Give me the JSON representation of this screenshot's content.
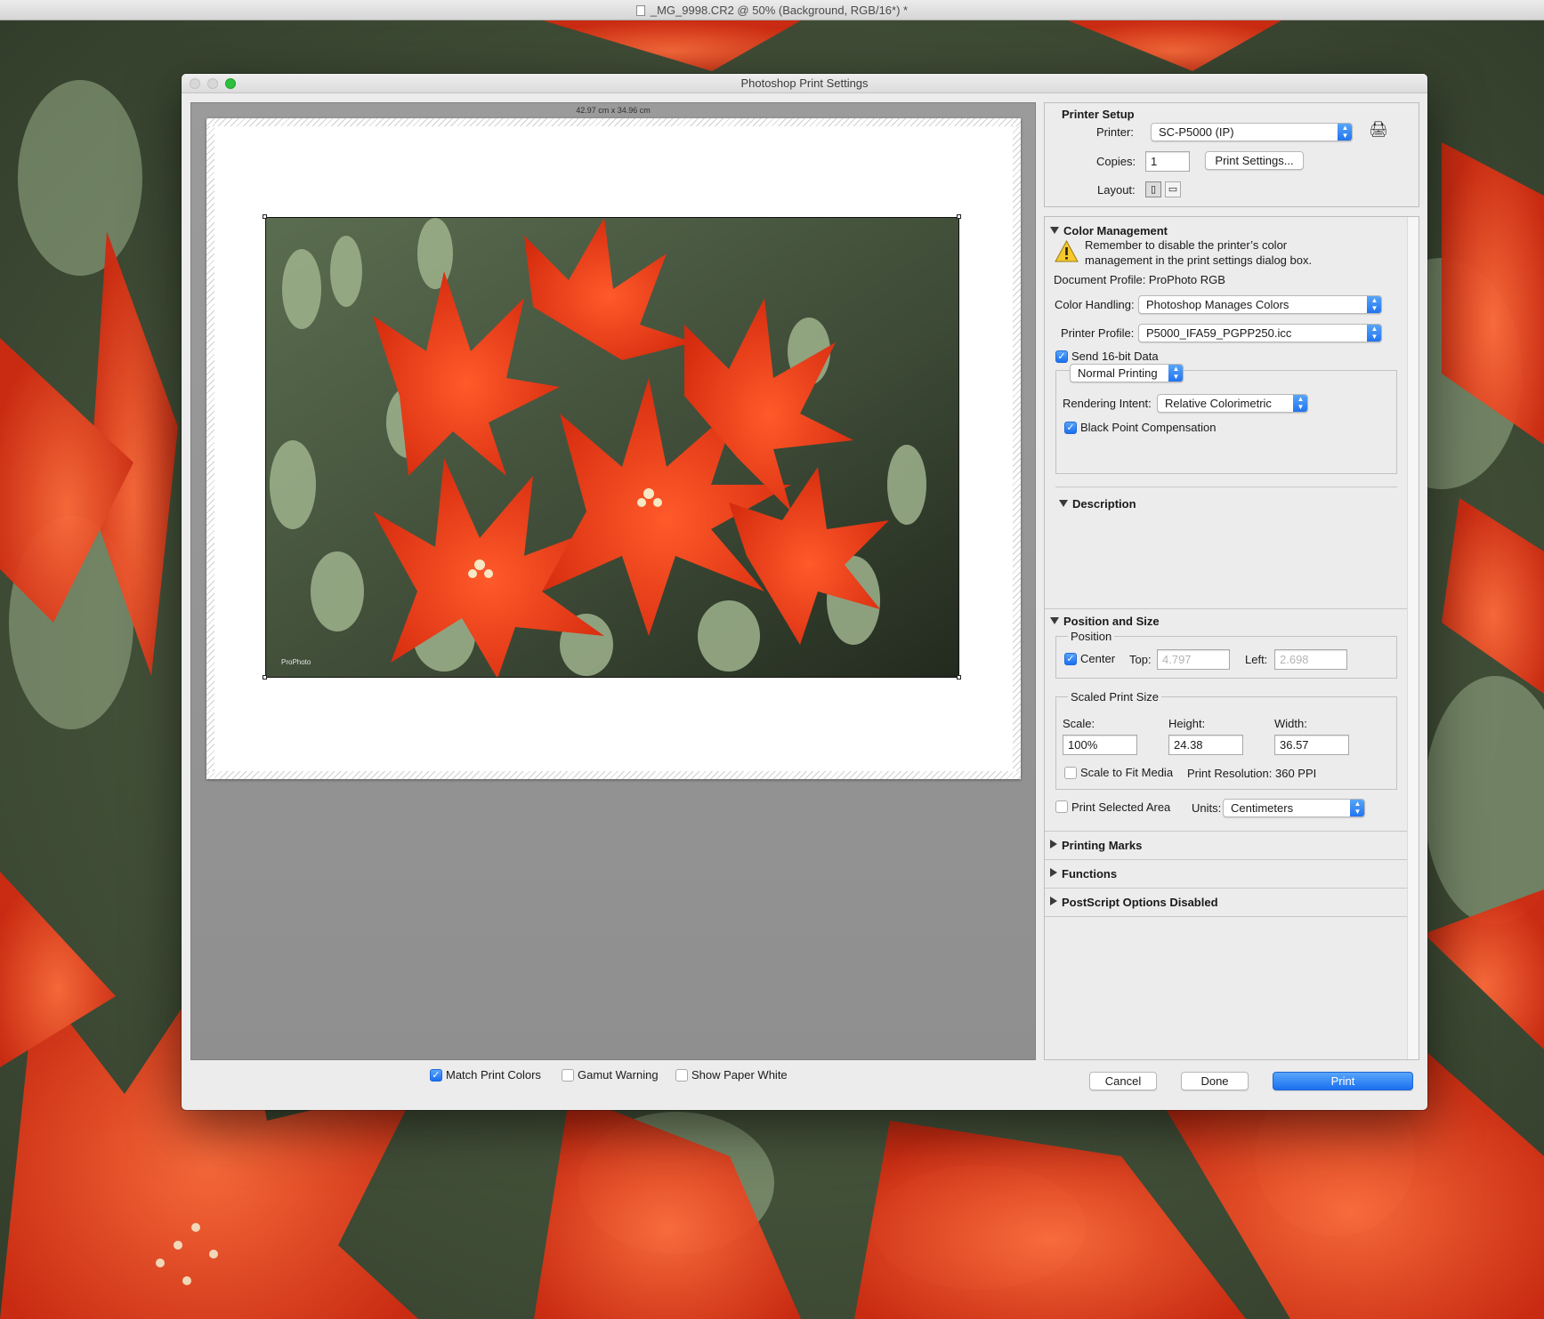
{
  "document": {
    "title": "_MG_9998.CR2 @ 50% (Background, RGB/16*) *"
  },
  "dialog": {
    "title": "Photoshop Print Settings",
    "paper_size_label": "42.97 cm x 34.96 cm",
    "profile_tag": "ProPhoto",
    "printer_setup": {
      "heading": "Printer Setup",
      "printer_label": "Printer:",
      "printer_value": "SC-P5000 (IP)",
      "copies_label": "Copies:",
      "copies_value": "1",
      "print_settings_button": "Print Settings...",
      "layout_label": "Layout:"
    },
    "color_management": {
      "heading": "Color Management",
      "warning_line1": "Remember to disable the printer’s color",
      "warning_line2": "management in the print settings dialog box.",
      "document_profile": "Document Profile: ProPhoto RGB",
      "color_handling_label": "Color Handling:",
      "color_handling_value": "Photoshop Manages Colors",
      "printer_profile_label": "Printer Profile:",
      "printer_profile_value": "P5000_IFA59_PGPP250.icc",
      "send_16bit_label": "Send 16-bit Data",
      "send_16bit_checked": true,
      "normal_printing_value": "Normal Printing",
      "rendering_intent_label": "Rendering Intent:",
      "rendering_intent_value": "Relative Colorimetric",
      "black_point_label": "Black Point Compensation",
      "black_point_checked": true
    },
    "description": {
      "heading": "Description"
    },
    "position_size": {
      "heading": "Position and Size",
      "position_label": "Position",
      "center_label": "Center",
      "center_checked": true,
      "top_label": "Top:",
      "top_value": "4.797",
      "left_label": "Left:",
      "left_value": "2.698",
      "scaled_label": "Scaled Print Size",
      "scale_label": "Scale:",
      "scale_value": "100%",
      "height_label": "Height:",
      "height_value": "24.38",
      "width_label": "Width:",
      "width_value": "36.57",
      "scale_to_fit_label": "Scale to Fit Media",
      "scale_to_fit_checked": false,
      "print_resolution": "Print Resolution: 360 PPI",
      "print_selected_label": "Print Selected Area",
      "print_selected_checked": false,
      "units_label": "Units:",
      "units_value": "Centimeters"
    },
    "collapsed_sections": [
      "Printing Marks",
      "Functions",
      "PostScript Options Disabled"
    ],
    "bottom": {
      "match_print_colors": "Match Print Colors",
      "match_print_colors_checked": true,
      "gamut_warning": "Gamut Warning",
      "gamut_warning_checked": false,
      "show_paper_white": "Show Paper White",
      "show_paper_white_checked": false,
      "cancel": "Cancel",
      "done": "Done",
      "print": "Print"
    }
  },
  "colors": {
    "accent_blue": "#1b6ff0",
    "flower_red": "#e8381a",
    "cactus_green": "#7d9a6a"
  }
}
